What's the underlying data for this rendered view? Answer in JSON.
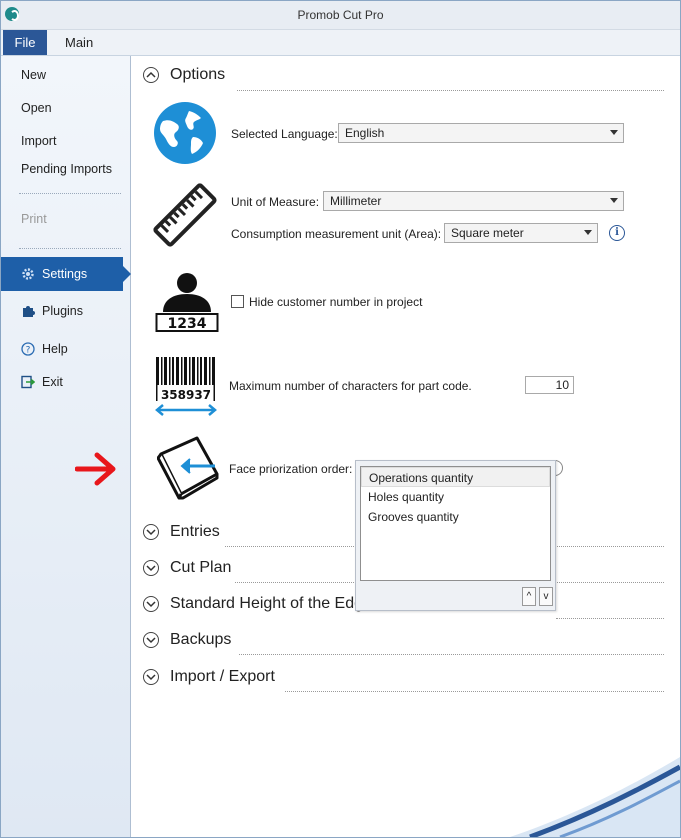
{
  "window": {
    "title": "Promob Cut Pro"
  },
  "ribbon": {
    "tabs": [
      "File",
      "Main"
    ]
  },
  "sidebar": {
    "items": [
      {
        "label": "New"
      },
      {
        "label": "Open"
      },
      {
        "label": "Import"
      },
      {
        "label": "Pending Imports"
      },
      {
        "label": "Print"
      },
      {
        "label": "Settings",
        "icon": "gear-icon"
      },
      {
        "label": "Plugins",
        "icon": "puzzle-icon"
      },
      {
        "label": "Help",
        "icon": "help-icon"
      },
      {
        "label": "Exit",
        "icon": "exit-icon"
      }
    ]
  },
  "options": {
    "title": "Options",
    "language": {
      "label": "Selected Language:",
      "value": "English"
    },
    "unit": {
      "label": "Unit of Measure:",
      "value": "Millimeter"
    },
    "consumption": {
      "label": "Consumption measurement unit (Area):",
      "value": "Square meter"
    },
    "customer": {
      "label": "Hide customer number in project",
      "icon_text": "1234"
    },
    "partcode": {
      "label": "Maximum number of characters for part code.",
      "value": "10",
      "icon_text": "358937"
    },
    "face": {
      "label": "Face priorization order:"
    }
  },
  "dropdown": {
    "items": [
      "Operations quantity",
      "Holes quantity",
      "Grooves quantity"
    ],
    "up": "^",
    "down": "v"
  },
  "sections": [
    "Entries",
    "Cut Plan",
    "Standard Height of the Edg",
    "Backups",
    "Import / Export"
  ],
  "colors": {
    "accent": "#1e5fa8",
    "arrow": "#e8161b",
    "icon_blue": "#1e8fd6"
  }
}
